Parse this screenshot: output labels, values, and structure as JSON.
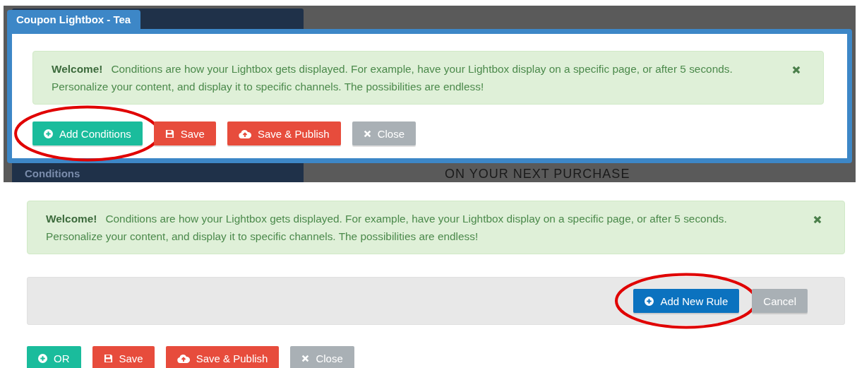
{
  "background": {
    "panel_label": "Conditions",
    "banner_text": "ON YOUR NEXT PURCHASE"
  },
  "modal": {
    "tab_title": "Coupon Lightbox - Tea",
    "alert": {
      "title": "Welcome!",
      "message": "Conditions are how your Lightbox gets displayed. For example, have your Lightbox display on a specific page, or after 5 seconds.\nPersonalize your content, and display it to specific channels. The possibilities are endless!"
    },
    "buttons": [
      {
        "label": "Add Conditions",
        "kind": "add",
        "circled": true
      },
      {
        "label": "Save",
        "kind": "save",
        "circled": false
      },
      {
        "label": "Save & Publish",
        "kind": "publish",
        "circled": false
      },
      {
        "label": "Close",
        "kind": "close",
        "circled": false
      }
    ]
  },
  "editor": {
    "alert": {
      "title": "Welcome!",
      "message": "Conditions are how your Lightbox gets displayed. For example, have your Lightbox display on a specific page, or after 5 seconds.\nPersonalize your content, and display it to specific channels. The possibilities are endless!"
    },
    "rule_bar_buttons": [
      {
        "label": "Add New Rule",
        "kind": "add-rule",
        "circled": true
      },
      {
        "label": "Cancel",
        "kind": "cancel",
        "circled": false
      }
    ],
    "buttons": [
      {
        "label": "OR",
        "kind": "add",
        "circled": false
      },
      {
        "label": "Save",
        "kind": "save",
        "circled": false
      },
      {
        "label": "Save & Publish",
        "kind": "publish",
        "circled": false
      },
      {
        "label": "Close",
        "kind": "close",
        "circled": false
      }
    ]
  }
}
